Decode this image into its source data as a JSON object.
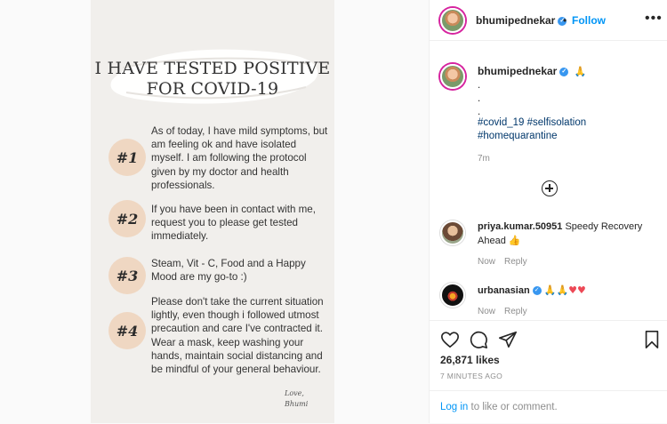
{
  "post": {
    "title_line1": "I HAVE TESTED POSITIVE",
    "title_line2": "FOR COVID-19",
    "steps": [
      {
        "badge": "#1",
        "text": "As of today, I have mild symptoms, but am feeling ok and have isolated myself. I am following the protocol given by my doctor and health professionals."
      },
      {
        "badge": "#2",
        "text": "If you have been in contact with me, request you to please get tested immediately."
      },
      {
        "badge": "#3",
        "text": "Steam, Vit - C, Food and a Happy Mood are my go-to :)"
      },
      {
        "badge": "#4",
        "text": "Please don't take the current situation lightly, even though i followed utmost precaution and care I've contracted it. Wear a mask, keep washing your hands, maintain social distancing and be mindful of your general behaviour."
      }
    ],
    "signoff_line1": "Love,",
    "signoff_line2": "Bhumi"
  },
  "header": {
    "username": "bhumipednekar",
    "separator": "•",
    "follow_label": "Follow",
    "more_label": "•••"
  },
  "caption": {
    "username": "bhumipednekar",
    "emoji": "🙏",
    "dots": [
      ".",
      ".",
      "."
    ],
    "hashtags_line1": "#covid_19 #selfisolation",
    "hashtags_line2": "#homequarantine",
    "time": "7m"
  },
  "comments": [
    {
      "username": "priya.kumar.50951",
      "text": "Speedy Recovery Ahead",
      "emoji": "👍",
      "time": "Now",
      "reply": "Reply"
    },
    {
      "username": "urbanasian",
      "emoji": "🙏🙏",
      "hearts": "♥♥",
      "time": "Now",
      "reply": "Reply"
    }
  ],
  "actions": {
    "likes": "26,871 likes",
    "ago": "7 MINUTES AGO",
    "login_link": "Log in",
    "login_rest": " to like or comment."
  },
  "colors": {
    "accent": "#0095f6",
    "badge_bg": "#efd7c2",
    "media_bg": "#f1efec",
    "heart": "#ed4956"
  },
  "icons": [
    "verified-badge-icon",
    "more-options-icon",
    "add-comment-icon",
    "heart-icon",
    "comment-icon",
    "share-icon",
    "bookmark-icon"
  ]
}
